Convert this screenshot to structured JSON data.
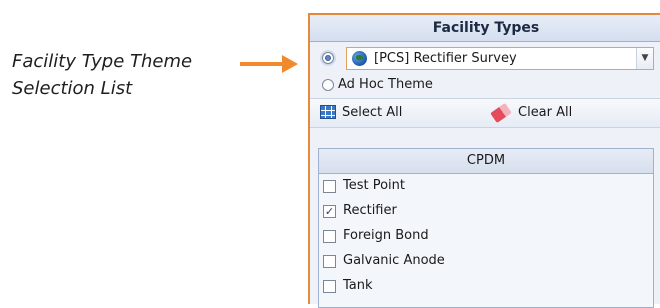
{
  "callout": {
    "line1": "Facility Type Theme",
    "line2": "Selection List",
    "arrow_color": "#f08a2c"
  },
  "panel": {
    "title": "Facility Types",
    "theme_combo": {
      "value": "[PCS] Rectifier Survey",
      "icon": "globe-icon",
      "selected": true
    },
    "adhoc": {
      "label": "Ad Hoc Theme",
      "selected": false
    },
    "buttons": {
      "select_all": "Select All",
      "clear_all": "Clear All"
    },
    "group": {
      "title": "CPDM",
      "items": [
        {
          "label": "Test Point",
          "checked": false
        },
        {
          "label": "Rectifier",
          "checked": true
        },
        {
          "label": "Foreign Bond",
          "checked": false
        },
        {
          "label": "Galvanic Anode",
          "checked": false
        },
        {
          "label": "Tank",
          "checked": false
        }
      ]
    },
    "accent_color": "#e38a3c"
  }
}
